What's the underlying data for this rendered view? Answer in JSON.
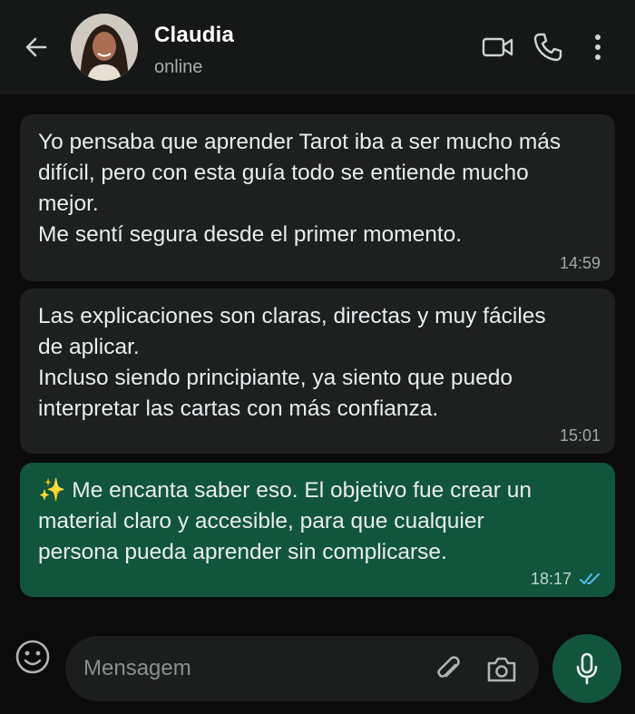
{
  "header": {
    "contact_name": "Claudia",
    "status": "online",
    "icons": [
      "back-arrow-icon",
      "video-call-icon",
      "voice-call-icon",
      "more-options-icon"
    ]
  },
  "messages": [
    {
      "direction": "incoming",
      "lines": [
        "Yo pensaba que aprender Tarot iba a ser mucho más",
        "difícil, pero con esta guía todo se entiende mucho",
        "mejor.",
        "Me sentí segura desde el primer momento."
      ],
      "time": "14:59"
    },
    {
      "direction": "incoming",
      "lines": [
        "Las explicaciones son claras, directas y muy fáciles",
        "de aplicar.",
        "Incluso siendo principiante, ya siento que puedo",
        "interpretar las cartas con más confianza."
      ],
      "time": "15:01"
    },
    {
      "direction": "outgoing",
      "lines": [
        "✨ Me encanta saber eso. El objetivo fue crear un",
        "material claro y accesible, para que cualquier",
        "persona pueda aprender sin complicarse."
      ],
      "time": "18:17",
      "status_icon": "double-check-read-icon"
    }
  ],
  "composer": {
    "placeholder": "Mensagem",
    "icons": [
      "emoji-icon",
      "attach-icon",
      "camera-icon",
      "microphone-icon"
    ]
  },
  "colors": {
    "background": "#0b0b0b",
    "header": "#161717",
    "incoming_bubble": "#1e1f1f",
    "outgoing_bubble": "#12553d",
    "read_check": "#53bdeb"
  }
}
